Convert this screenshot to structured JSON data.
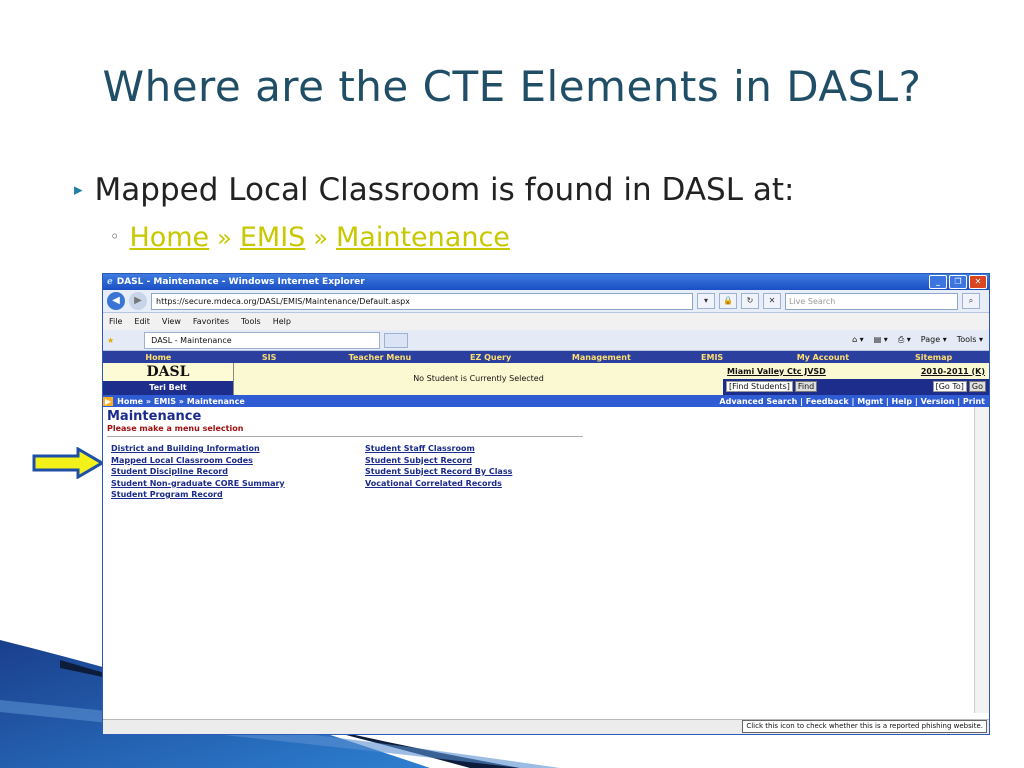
{
  "slide": {
    "title": "Where are the CTE Elements in DASL?",
    "bullet": "Mapped Local Classroom is found in DASL at:",
    "path": [
      "Home",
      "EMIS",
      "Maintenance"
    ],
    "path_sep": "»",
    "bullet_marker": "▸",
    "sub_marker": "◦"
  },
  "browser": {
    "title": "DASL - Maintenance - Windows Internet Explorer",
    "url": "https://secure.mdeca.org/DASL/EMIS/Maintenance/Default.aspx",
    "search_placeholder": "Live Search",
    "menu": [
      "File",
      "Edit",
      "View",
      "Favorites",
      "Tools",
      "Help"
    ],
    "tab_label": "DASL - Maintenance",
    "commands": [
      "Page ▾",
      "Tools ▾"
    ],
    "status_tooltip": "Click this icon to check whether this is a reported phishing website."
  },
  "app": {
    "nav": [
      "Home",
      "SIS",
      "Teacher Menu",
      "EZ Query",
      "Management",
      "EMIS",
      "My Account",
      "Sitemap"
    ],
    "logo": "DASL",
    "user": "Teri Belt",
    "no_student": "No Student is Currently Selected",
    "district": "Miami Valley Ctc JVSD",
    "year": "2010-2011 (K)",
    "find_students": "[Find Students]",
    "find": "Find",
    "go_to": "[Go To]",
    "go": "Go",
    "breadcrumb": "Home  » EMIS  » Maintenance",
    "toplinks": "Advanced Search | Feedback | Mgmt | Help | Version | Print",
    "heading": "Maintenance",
    "prompt": "Please make a menu selection",
    "col1": [
      "District and Building Information",
      "Mapped Local Classroom Codes",
      "Student Discipline Record",
      "Student Non-graduate CORE Summary",
      "Student Program Record"
    ],
    "col2": [
      "Student Staff Classroom",
      "Student Subject Record",
      "Student Subject Record By Class",
      "Vocational Correlated Records"
    ]
  },
  "colors": {
    "accent": "#c8c800",
    "title": "#1f4e66",
    "app_nav": "#2b3f9e"
  }
}
